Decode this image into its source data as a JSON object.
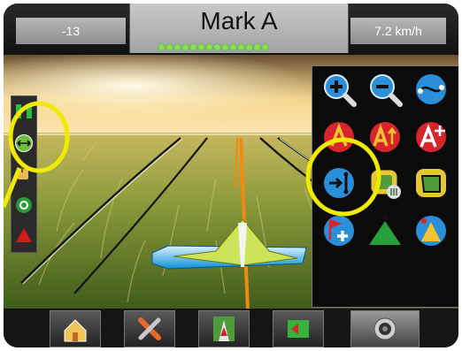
{
  "header": {
    "left_value": "-13",
    "title": "Mark A",
    "right_value": "7.2 km/h",
    "lightbar_count": 14,
    "lightbar_color": "#8ee040"
  },
  "left_toolbar": {
    "icons": [
      "bars-icon",
      "line-guide-icon",
      "rest-icon",
      "boundary-settings-icon",
      "vehicle-marker-icon"
    ]
  },
  "guidance_panel": {
    "buttons": [
      "zoom-in-icon",
      "zoom-out-icon",
      "perspective-icon",
      "mark-a-icon",
      "mark-a-plus-icon",
      "mark-a-nudge-icon",
      "return-to-point-icon",
      "delete-application-icon",
      "boundary-icon",
      "add-marker-icon",
      "vehicle-icon",
      "apply-icon"
    ]
  },
  "bottom_nav": {
    "tabs": [
      "home-icon",
      "tools-icon",
      "guidance-view-icon",
      "guidance-cam-icon",
      "camera-icon"
    ]
  },
  "annotation_color": "#f0ea00"
}
